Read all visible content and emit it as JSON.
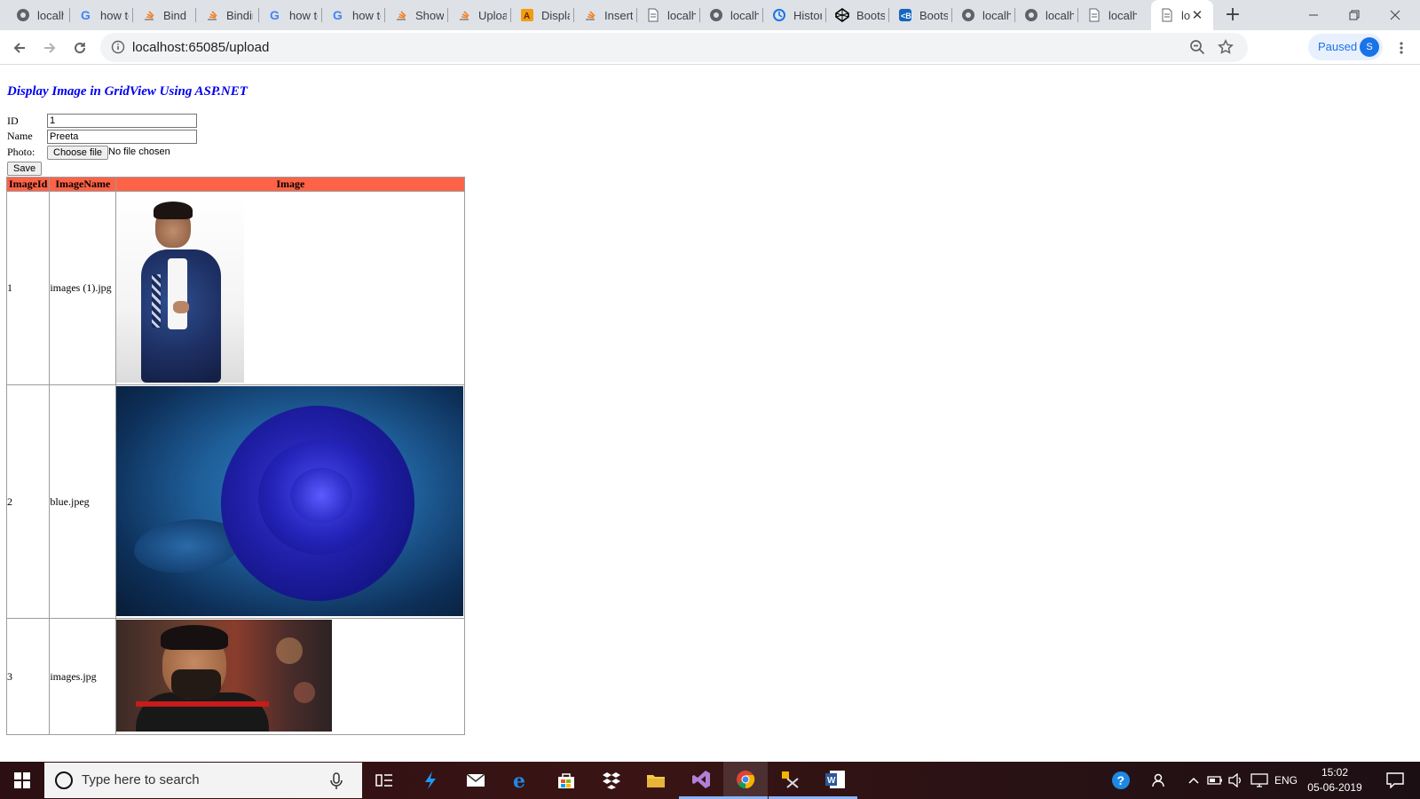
{
  "browser": {
    "tabs": [
      {
        "title": "localhost",
        "icon": "globe-icon"
      },
      {
        "title": "how to",
        "icon": "google-icon"
      },
      {
        "title": "Bind",
        "icon": "stackoverflow-icon"
      },
      {
        "title": "Binding",
        "icon": "stackoverflow-icon"
      },
      {
        "title": "how to",
        "icon": "google-icon"
      },
      {
        "title": "how to",
        "icon": "google-icon"
      },
      {
        "title": "Show",
        "icon": "stackoverflow-icon"
      },
      {
        "title": "Upload",
        "icon": "stackoverflow-icon"
      },
      {
        "title": "Display",
        "icon": "aspsnippets-icon"
      },
      {
        "title": "Insert",
        "icon": "stackoverflow-icon"
      },
      {
        "title": "localhost",
        "icon": "page-icon"
      },
      {
        "title": "localhost",
        "icon": "globe-icon"
      },
      {
        "title": "History",
        "icon": "history-icon"
      },
      {
        "title": "Bootstrap",
        "icon": "codepen-icon"
      },
      {
        "title": "Bootstrap",
        "icon": "bootstrap-icon"
      },
      {
        "title": "localhost",
        "icon": "globe-icon"
      },
      {
        "title": "localhost",
        "icon": "globe-icon"
      },
      {
        "title": "localhost",
        "icon": "page-icon"
      },
      {
        "title": "localhost",
        "icon": "page-icon",
        "active": true
      }
    ],
    "url": "localhost:65085/upload",
    "profile_status": "Paused",
    "profile_initial": "S"
  },
  "page": {
    "title": "Display Image in GridView Using ASP.NET",
    "form": {
      "id_label": "ID",
      "id_value": "1",
      "name_label": "Name",
      "name_value": "Preeta",
      "photo_label": "Photo:",
      "choose_file_label": "Choose file",
      "file_status": "No file chosen",
      "save_label": "Save"
    },
    "grid": {
      "header_color": "#ff6347",
      "columns": [
        "ImageId",
        "ImageName",
        "Image"
      ],
      "rows": [
        {
          "id": "1",
          "name": "images (1).jpg",
          "photo": "man-in-blue-suit"
        },
        {
          "id": "2",
          "name": "blue.jpeg",
          "photo": "blue-rose"
        },
        {
          "id": "3",
          "name": "images.jpg",
          "photo": "cricket-player"
        }
      ]
    }
  },
  "taskbar": {
    "search_placeholder": "Type here to search",
    "apps": [
      "task-view-icon",
      "sharex-icon",
      "mail-icon",
      "edge-icon",
      "store-icon",
      "dropbox-icon",
      "file-explorer-icon",
      "visual-studio-icon",
      "chrome-icon",
      "tools-icon",
      "word-icon"
    ],
    "language": "ENG",
    "time": "15:02",
    "date": "05-06-2019"
  }
}
